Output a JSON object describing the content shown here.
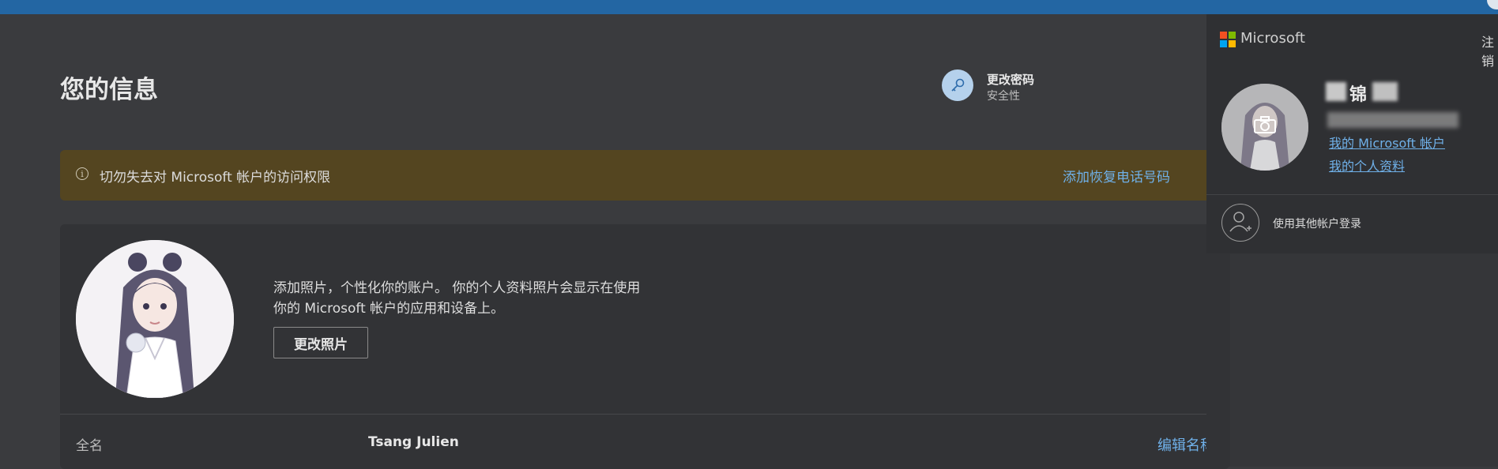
{
  "main": {
    "title": "您的信息",
    "change_password": {
      "title": "更改密码",
      "subtitle": "安全性"
    },
    "banner": {
      "icon": "info-icon",
      "text": "切勿失去对 Microsoft 帐户的访问权限",
      "link": "添加恢复电话号码"
    },
    "photo": {
      "description": "添加照片，个性化你的账户。 你的个人资料照片会显示在使用你的 Microsoft 帐户的应用和设备上。",
      "button": "更改照片"
    },
    "fullname": {
      "label": "全名",
      "value": "Tsang Julien",
      "edit": "编辑名称"
    }
  },
  "flyout": {
    "brand": "Microsoft",
    "signout": "注销",
    "account_name": "锦",
    "links": {
      "my_account": "我的 Microsoft 帐户",
      "my_profile": "我的个人资料"
    },
    "other_account": "使用其他帐户登录"
  },
  "colors": {
    "top_bar": "#2366a3",
    "link": "#6fb0e8",
    "banner_bg": "#544520",
    "background": "#3a3b3e"
  }
}
